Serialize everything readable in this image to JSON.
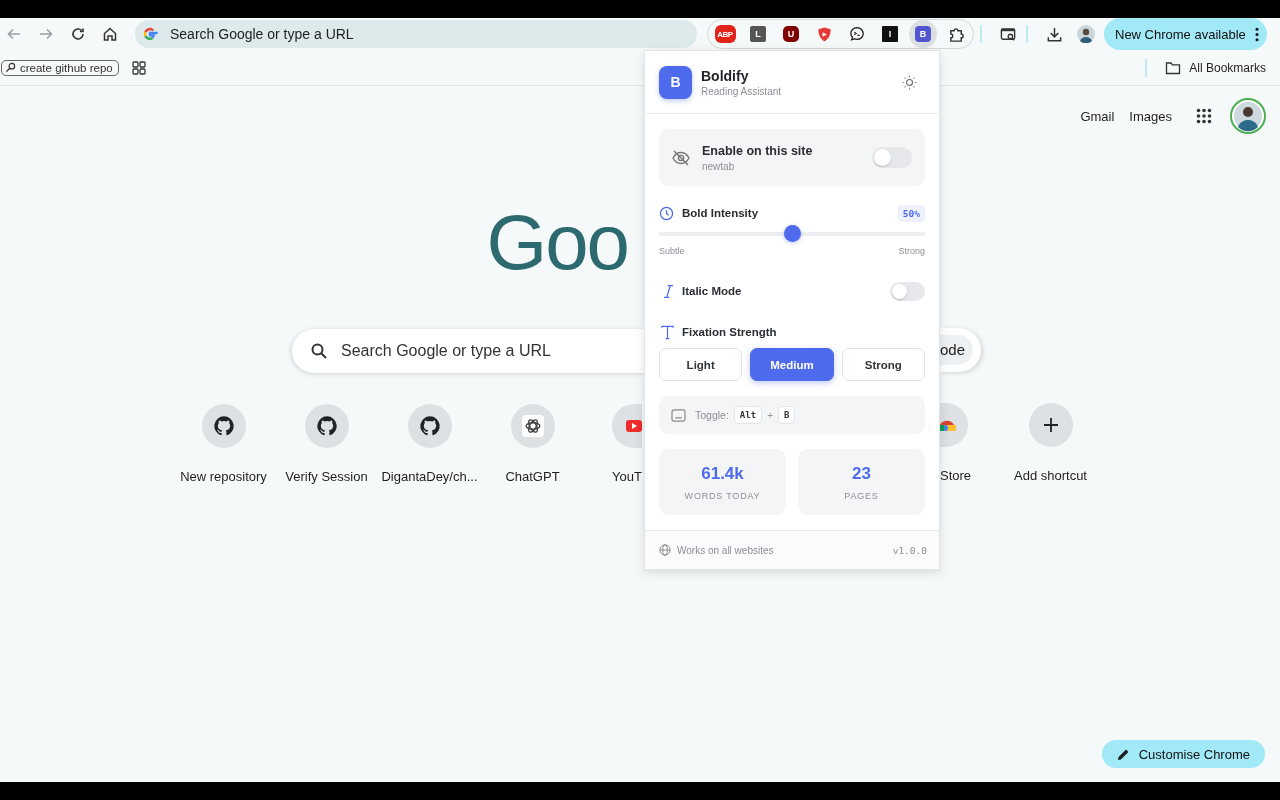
{
  "toolbar": {
    "omnibox": {
      "placeholder": "Search Google or type a URL"
    },
    "extensions": [
      {
        "kind": "abp",
        "label": "ABP",
        "selected": false
      },
      {
        "kind": "grey-square",
        "label": "L",
        "selected": false
      },
      {
        "kind": "red-octagon",
        "label": "U",
        "selected": false
      },
      {
        "kind": "shield",
        "selected": false
      },
      {
        "kind": "bubble",
        "selected": false
      },
      {
        "kind": "dark-square",
        "label": "I",
        "selected": false
      },
      {
        "kind": "blue-square",
        "label": "B",
        "selected": true
      },
      {
        "kind": "puzzle",
        "selected": false
      }
    ],
    "update_button": "New Chrome available"
  },
  "bookmarks_bar": {
    "items": [
      {
        "label": "create github repo"
      }
    ],
    "all_bookmarks": "All Bookmarks"
  },
  "header_links": [
    "Gmail",
    "Images"
  ],
  "logo": "Goo",
  "search": {
    "placeholder": "Search Google or type a URL",
    "mode_chip": "ode"
  },
  "shortcuts": [
    {
      "kind": "github",
      "label": "New repository"
    },
    {
      "kind": "github",
      "label": "Verify Session"
    },
    {
      "kind": "github",
      "label": "DigantaDey/ch..."
    },
    {
      "kind": "chatgpt",
      "label": "ChatGPT"
    },
    {
      "kind": "youtube",
      "label": "YouT"
    },
    {
      "kind": "webstore",
      "label": "Store"
    },
    {
      "kind": "add",
      "label": "Add shortcut"
    }
  ],
  "customise_button": "Customise Chrome",
  "popup": {
    "logo_letter": "B",
    "title": "Boldify",
    "subtitle": "Reading Assistant",
    "enable": {
      "label": "Enable on this site",
      "site": "newtab",
      "on": false
    },
    "intensity": {
      "label": "Bold Intensity",
      "value": "50%",
      "level": 0.5,
      "min_label": "Subtle",
      "max_label": "Strong"
    },
    "italic": {
      "label": "Italic Mode",
      "on": false
    },
    "fixation": {
      "label": "Fixation Strength",
      "options": [
        {
          "label": "Light",
          "selected": false
        },
        {
          "label": "Medium",
          "selected": true
        },
        {
          "label": "Strong",
          "selected": false
        }
      ]
    },
    "shortcut": {
      "label": "Toggle:",
      "keys": [
        "Alt",
        "B"
      ],
      "joiner": "+"
    },
    "stats": [
      {
        "value": "61.4k",
        "label": "WORDS TODAY"
      },
      {
        "value": "23",
        "label": "PAGES"
      }
    ],
    "footer": {
      "note": "Works on all websites",
      "version": "v1.0.0"
    }
  }
}
